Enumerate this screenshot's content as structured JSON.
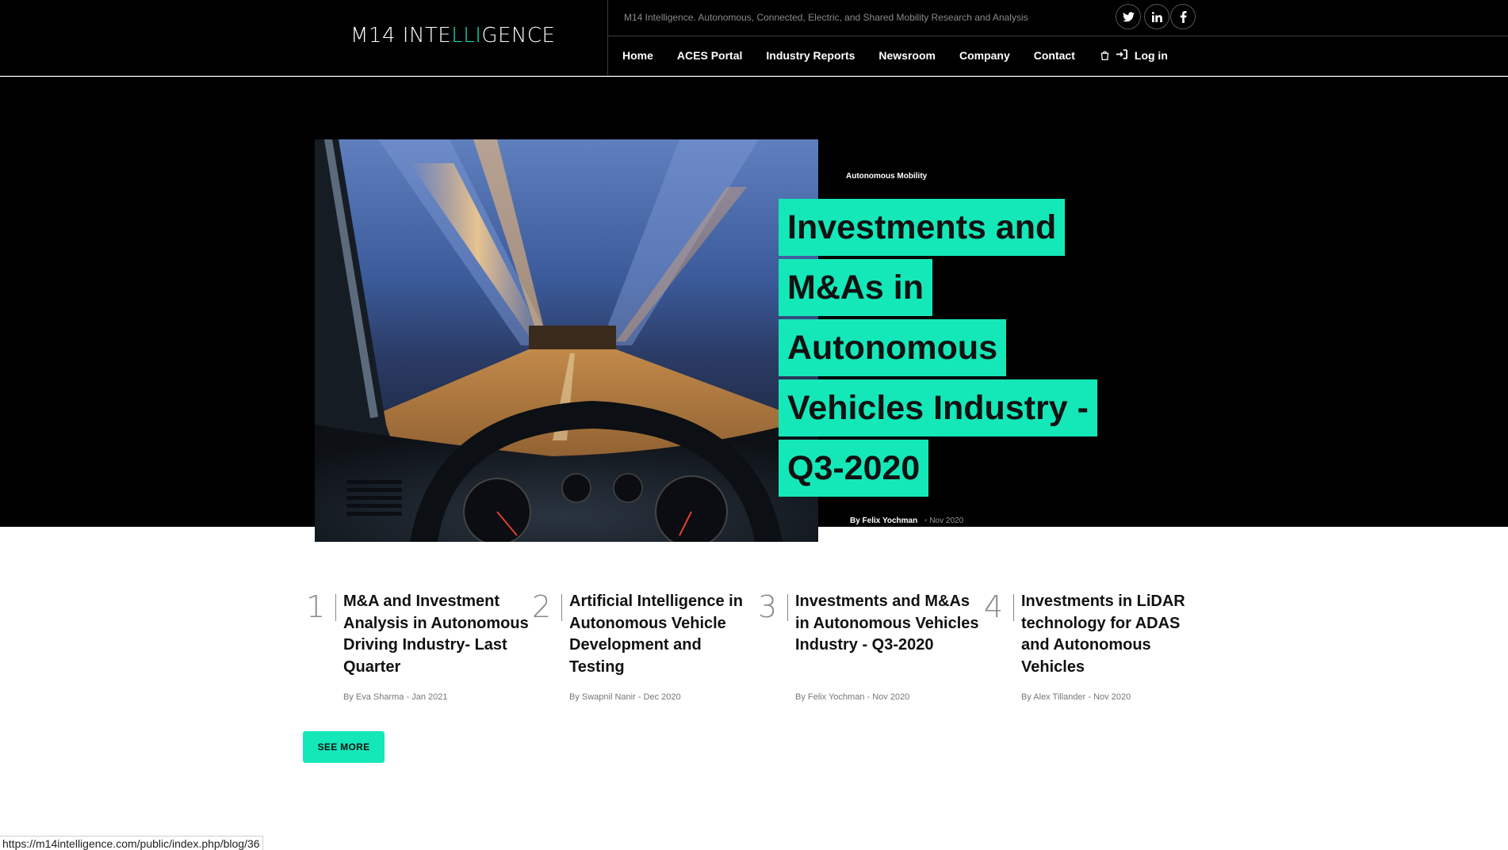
{
  "header": {
    "logo": {
      "part1": "M14 INTE",
      "accent": "LLI",
      "part2": "GENCE"
    },
    "tagline": "M14 Intelligence. Autonomous, Connected, Electric, and Shared Mobility Research and Analysis",
    "social": {
      "twitter": "twitter-icon",
      "linkedin": "linkedin-icon",
      "facebook": "facebook-icon"
    },
    "nav": [
      "Home",
      "ACES Portal",
      "Industry Reports",
      "Newsroom",
      "Company",
      "Contact"
    ],
    "cart_icon": "cart-icon",
    "login_icon": "login-icon",
    "login_label": "Log in"
  },
  "hero": {
    "category": "Autonomous Mobility",
    "title_lines": [
      "Investments and",
      "M&As in",
      "Autonomous",
      "Vehicles Industry -",
      "Q3-2020"
    ],
    "author": "By Felix Yochman",
    "date": "Nov 2020",
    "accent_color": "#14e8b8"
  },
  "articles": [
    {
      "num": "1",
      "title": "M&A and Investment Analysis in Autonomous Driving Industry- Last Quarter",
      "meta": "By Eva Sharma - Jan 2021"
    },
    {
      "num": "2",
      "title": "Artificial Intelligence in Autonomous Vehicle Development and Testing",
      "meta": "By Swapnil Nanir - Dec 2020"
    },
    {
      "num": "3",
      "title": "Investments and M&As in Autonomous Vehicles Industry - Q3-2020",
      "meta": "By Felix Yochman - Nov 2020"
    },
    {
      "num": "4",
      "title": "Investments in LiDAR technology for ADAS and Autonomous Vehicles",
      "meta": "By Alex Tillander - Nov 2020"
    }
  ],
  "see_more": "SEE MORE",
  "status_url": "https://m14intelligence.com/public/index.php/blog/36"
}
